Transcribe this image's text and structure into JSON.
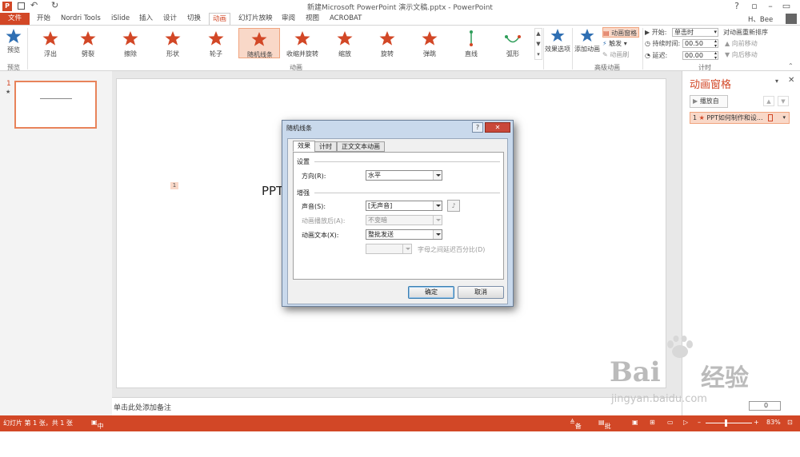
{
  "window": {
    "title": "新建Microsoft PowerPoint 演示文稿.pptx - PowerPoint",
    "help": "?",
    "user": "H、Bee"
  },
  "tabs": [
    "文件",
    "开始",
    "Nordri Tools",
    "iSlide",
    "插入",
    "设计",
    "切换",
    "动画",
    "幻灯片放映",
    "审阅",
    "视图",
    "ACROBAT"
  ],
  "ribbon": {
    "preview_label": "预览",
    "preview_group": "预览",
    "animations": [
      "浮出",
      "劈裂",
      "擦除",
      "形状",
      "轮子",
      "随机线条",
      "收缩并旋转",
      "缩放",
      "旋转",
      "弹跳",
      "直线",
      "弧形"
    ],
    "selected_animation": "随机线条",
    "animation_group": "动画",
    "effect_options": "效果选项",
    "add_animation": "添加动画",
    "animation_pane_btn": "动画窗格",
    "trigger_btn": "触发",
    "painter_btn": "动画刷",
    "advanced_group": "高级动画",
    "start_label": "开始:",
    "start_value": "单击时",
    "duration_label": "持续时间:",
    "duration_value": "00.50",
    "delay_label": "延迟:",
    "delay_value": "00.00",
    "reorder_label": "对动画重新排序",
    "move_earlier": "向前移动",
    "move_later": "向后移动",
    "timing_group": "计时"
  },
  "slides": {
    "number": "1",
    "star": "★"
  },
  "slide": {
    "visible_text": "PPT",
    "tag": "1",
    "notes_placeholder": "单击此处添加备注"
  },
  "anim_pane": {
    "title": "动画窗格",
    "play_btn": "播放自",
    "item_number": "1",
    "item_text": "PPT如何制作和设..."
  },
  "dialog": {
    "title": "随机线条",
    "tabs": [
      "效果",
      "计时",
      "正文文本动画"
    ],
    "settings_header": "设置",
    "direction_label": "方向(R):",
    "direction_value": "水平",
    "enhance_header": "增强",
    "sound_label": "声音(S):",
    "sound_value": "[无声音]",
    "after_label": "动画播放后(A):",
    "after_value": "不变暗",
    "text_label": "动画文本(X):",
    "text_value": "整批发送",
    "delay_pct_label": "字母之间延迟百分比(D)",
    "ok": "确定",
    "cancel": "取消"
  },
  "status": {
    "slide_info": "幻灯片 第 1 张，共 1 张",
    "language": "中文(中国)",
    "notes": "备注",
    "comments": "批注",
    "zoom": "83%",
    "page_field": "0"
  },
  "watermark": {
    "brand": "Bai",
    "brand_cn": "经验",
    "url": "jingyan.baidu.com"
  },
  "colors": {
    "accent": "#d24726",
    "selection": "#f9d8c8"
  }
}
